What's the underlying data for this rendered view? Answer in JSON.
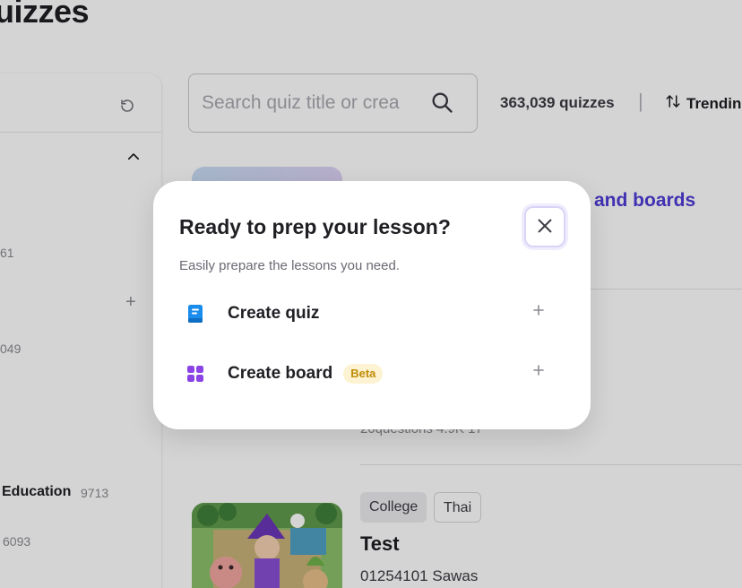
{
  "page": {
    "title": "uizzes",
    "search": {
      "placeholder": "Search quiz title or crea"
    },
    "quiz_count": "363,039 quizzes",
    "separator": "|",
    "sort_label": "Trendin",
    "promo_link": "and boards",
    "sidebar": {
      "counts": [
        "61",
        "049"
      ],
      "education_label": "Education",
      "education_count": "9713",
      "last_count": "6093"
    },
    "meta_row": "20questions   4.9K   17",
    "card": {
      "tags": [
        "College",
        "Thai"
      ],
      "title": "Test",
      "subtitle": "01254101 Sawas"
    }
  },
  "modal": {
    "title": "Ready to prep your lesson?",
    "subtitle": "Easily prepare the lessons you need.",
    "options": [
      {
        "label": "Create quiz",
        "icon": "book-icon",
        "icon_color": "#1a8cec"
      },
      {
        "label": "Create board",
        "icon": "grid-icon",
        "icon_color": "#8b43e6",
        "badge": "Beta"
      }
    ]
  },
  "colors": {
    "accent_link": "#4d3bd6",
    "beta_badge_bg": "#fdf3d2",
    "beta_badge_text": "#c18b06",
    "close_border": "#d9d4f7"
  }
}
